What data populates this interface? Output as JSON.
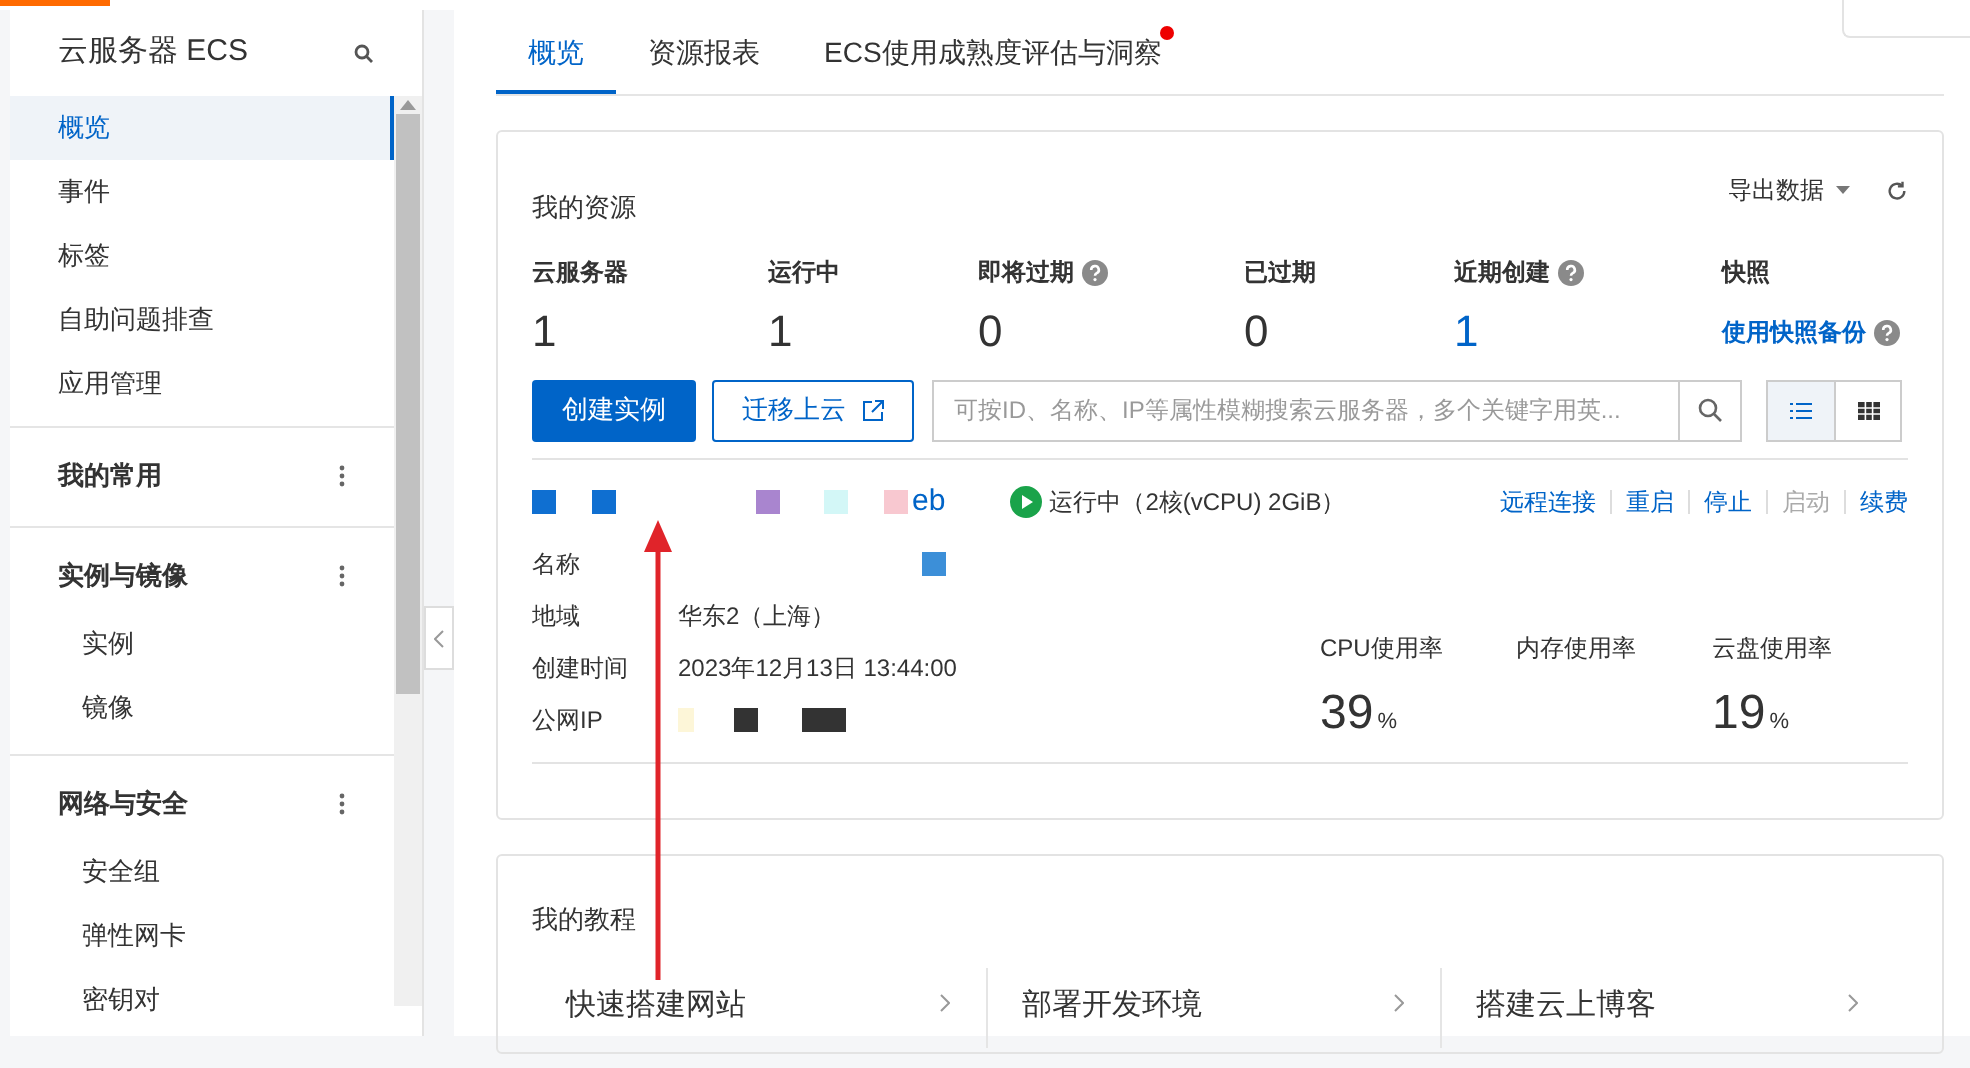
{
  "sidebar": {
    "title": "云服务器 ECS",
    "items": [
      {
        "kind": "item",
        "label": "概览",
        "selected": true
      },
      {
        "kind": "item",
        "label": "事件",
        "selected": false
      },
      {
        "kind": "item",
        "label": "标签",
        "selected": false
      },
      {
        "kind": "item",
        "label": "自助问题排查",
        "selected": false
      },
      {
        "kind": "item",
        "label": "应用管理",
        "selected": false
      },
      {
        "kind": "group",
        "label": "我的常用"
      },
      {
        "kind": "group",
        "label": "实例与镜像",
        "children": [
          {
            "label": "实例",
            "selected": false
          },
          {
            "label": "镜像",
            "selected": false
          }
        ]
      },
      {
        "kind": "group",
        "label": "网络与安全",
        "children": [
          {
            "label": "安全组",
            "selected": false
          },
          {
            "label": "弹性网卡",
            "selected": false
          },
          {
            "label": "密钥对",
            "selected": false
          }
        ]
      }
    ]
  },
  "tabs": [
    {
      "label": "概览",
      "selected": true,
      "dot": false
    },
    {
      "label": "资源报表",
      "selected": false,
      "dot": false
    },
    {
      "label": "ECS使用成熟度评估与洞察",
      "selected": false,
      "dot": true
    }
  ],
  "resources": {
    "title": "我的资源",
    "export": "导出数据",
    "stats": [
      {
        "label": "云服务器",
        "value": "1",
        "help": false,
        "link": false
      },
      {
        "label": "运行中",
        "value": "1",
        "help": false,
        "link": false
      },
      {
        "label": "即将过期",
        "value": "0",
        "help": true,
        "link": false
      },
      {
        "label": "已过期",
        "value": "0",
        "help": false,
        "link": false
      },
      {
        "label": "近期创建",
        "value": "1",
        "help": true,
        "link": true
      }
    ],
    "snapshot": {
      "label": "快照",
      "link": "使用快照备份"
    },
    "create_button": "创建实例",
    "migrate_button": "迁移上云",
    "search": {
      "placeholder": "可按ID、名称、IP等属性模糊搜索云服务器，多个关键字用英..."
    },
    "views": [
      {
        "kind": "list",
        "selected": true
      },
      {
        "kind": "grid",
        "selected": false
      }
    ]
  },
  "instance": {
    "name_tail": "eb",
    "status": "运行中（2核(vCPU) 2GiB）",
    "actions": [
      {
        "label": "远程连接",
        "disabled": false
      },
      {
        "label": "重启",
        "disabled": false
      },
      {
        "label": "停止",
        "disabled": false
      },
      {
        "label": "启动",
        "disabled": true
      },
      {
        "label": "续费",
        "disabled": false
      }
    ],
    "details": [
      {
        "label": "名称"
      },
      {
        "label": "地域",
        "value": "华东2（上海）"
      },
      {
        "label": "创建时间",
        "value": "2023年12月13日 13:44:00"
      },
      {
        "label": "公网IP"
      }
    ],
    "metrics": [
      {
        "label": "CPU使用率",
        "value": "39",
        "unit": "%"
      },
      {
        "label": "内存使用率"
      },
      {
        "label": "云盘使用率",
        "value": "19",
        "unit": "%"
      }
    ]
  },
  "tutorials": {
    "title": "我的教程",
    "items": [
      "快速搭建网站",
      "部署开发环境",
      "搭建云上博客"
    ]
  }
}
